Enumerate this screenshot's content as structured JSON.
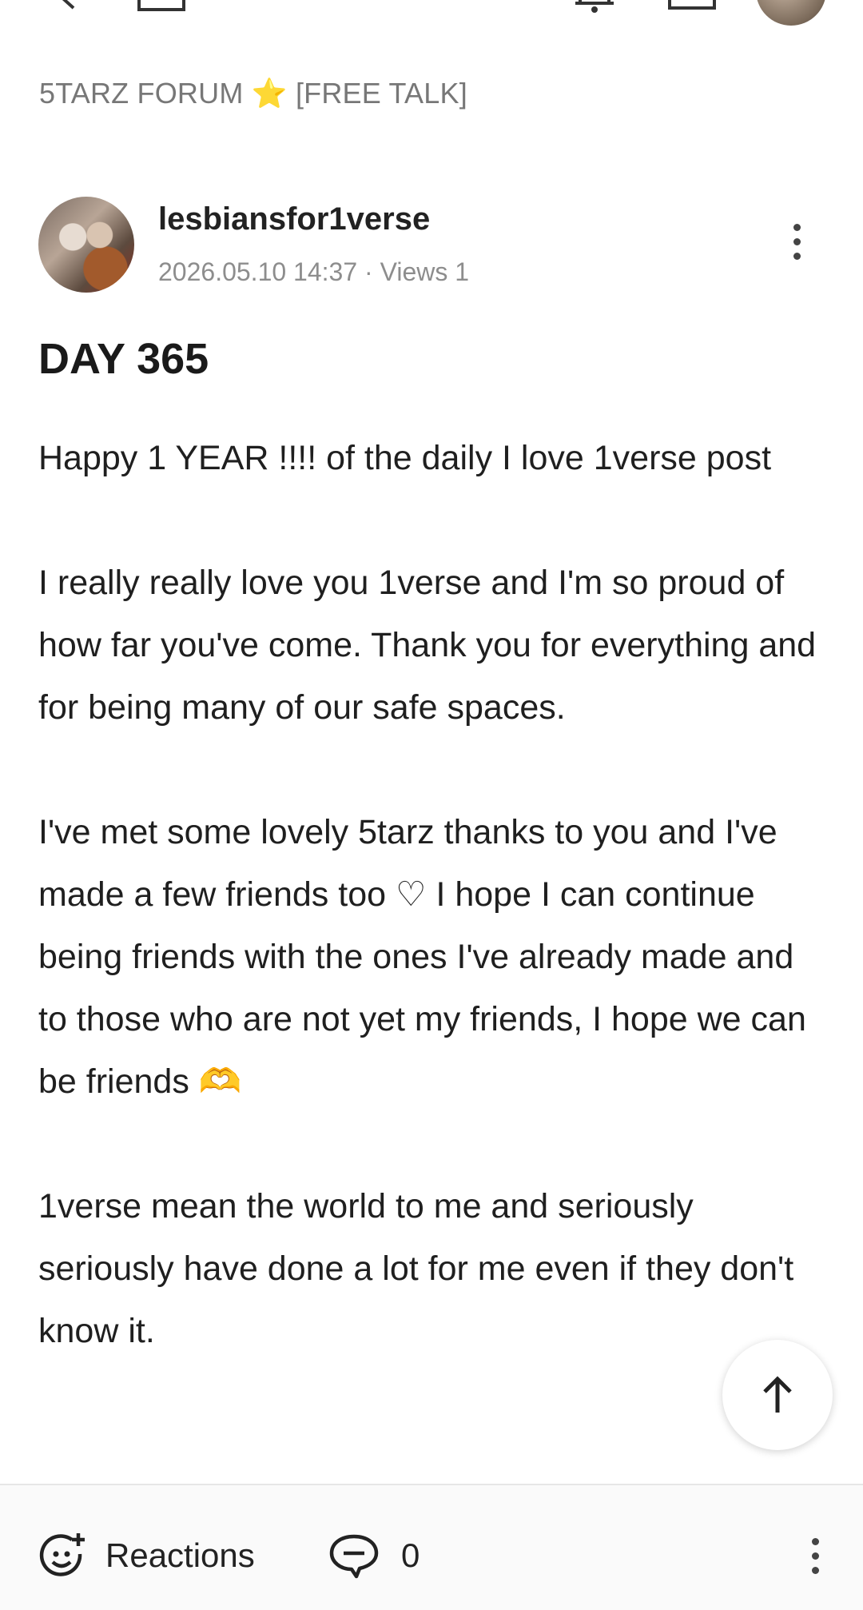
{
  "topbar": {
    "icons": [
      "back-icon",
      "home-icon",
      "bell-icon",
      "chat-icon",
      "profile-avatar"
    ]
  },
  "board": {
    "name": "5TARZ FORUM",
    "emoji": "⭐",
    "category": "[FREE TALK]"
  },
  "post": {
    "author": "lesbiansfor1verse",
    "date": "2026.05.10 14:37",
    "separator": "·",
    "views": "Views 1",
    "title": "DAY 365",
    "paragraphs": [
      "Happy 1 YEAR !!!! of the daily I love 1verse post",
      "I really really love you 1verse and I'm so proud of how far you've come. Thank you for everything and for being many of our safe spaces.",
      "I've met some lovely 5tarz thanks to you and I've made a few friends too ♡ I hope I can continue being friends with the ones I've already made and to those who are not yet my friends, I hope we can be friends 🫶",
      "1verse mean the world to me and seriously seriously have done a lot for me even if they don't know it."
    ]
  },
  "bottom_bar": {
    "reactions_label": "Reactions",
    "comment_count": "0"
  },
  "colors": {
    "accent_star": "#f2b81b",
    "muted_text": "#8d8d8d",
    "text": "#1f1f1f"
  }
}
